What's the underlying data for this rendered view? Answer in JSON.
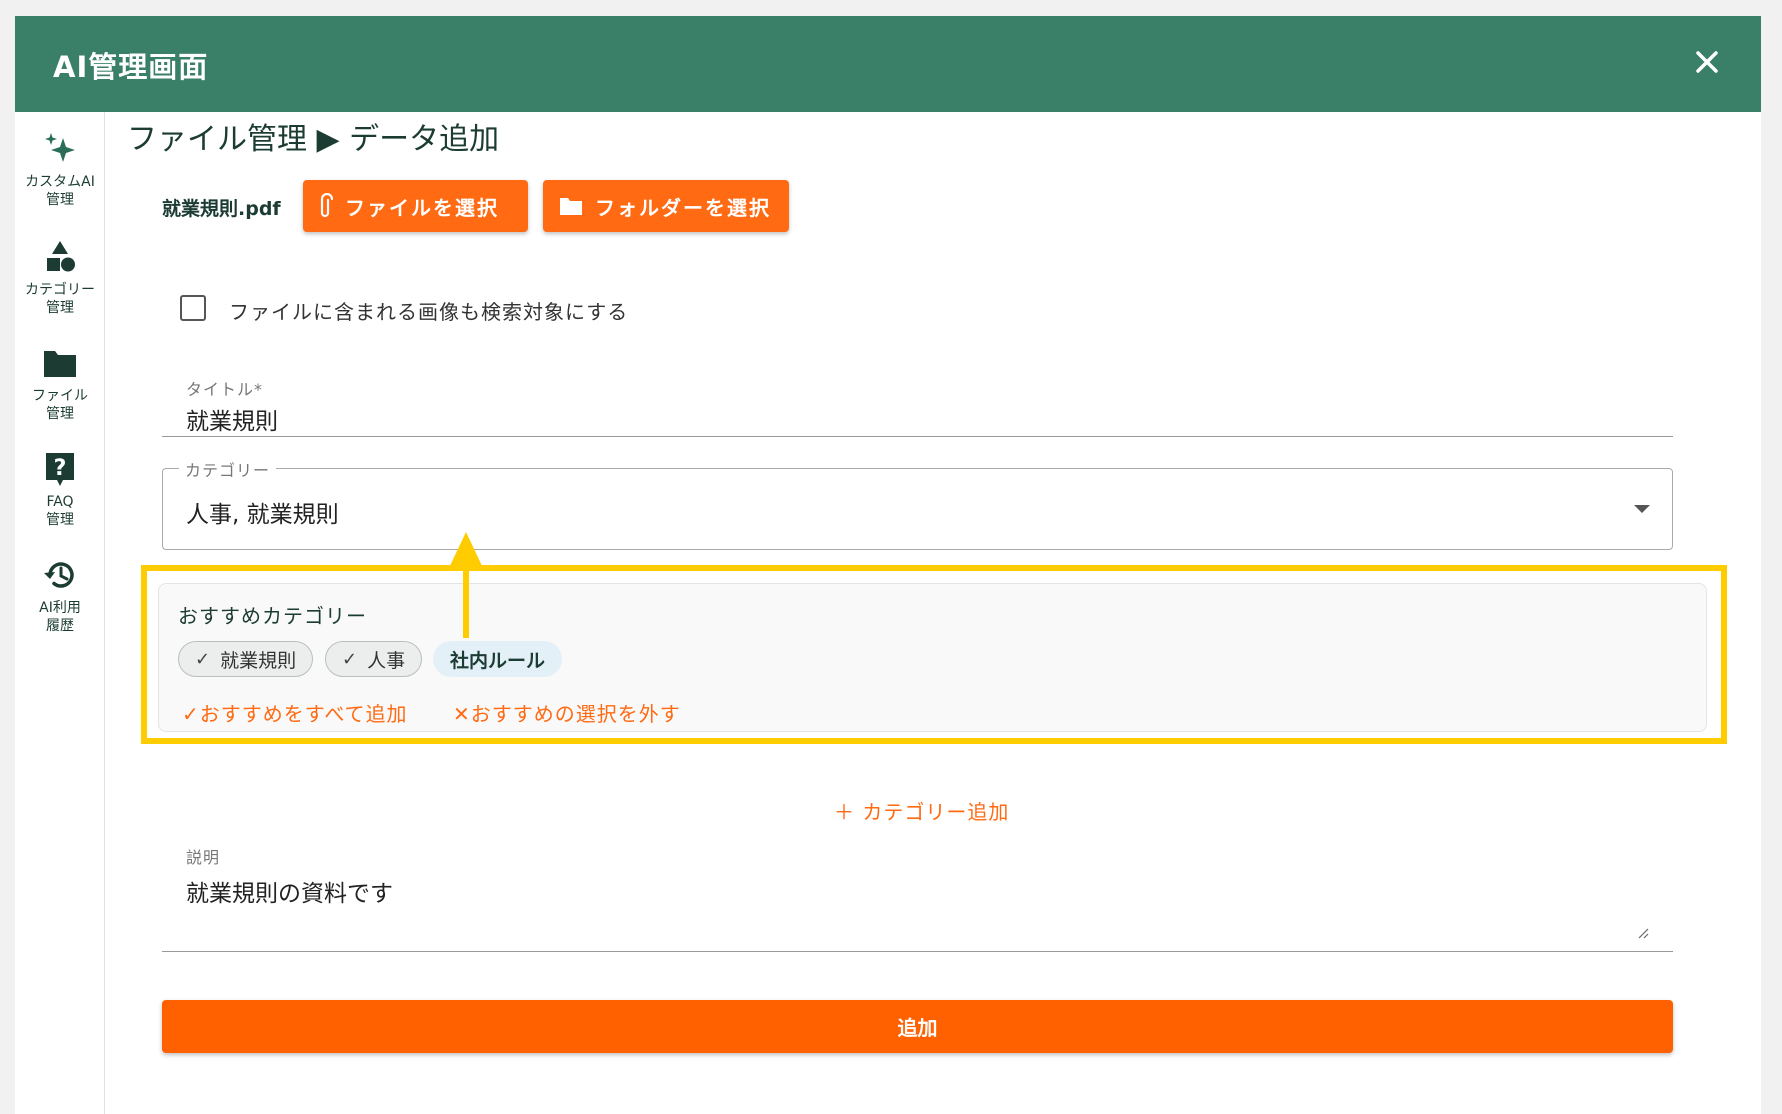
{
  "app": {
    "title": "AI管理画面",
    "header_color": "#3a7f68",
    "accent_color": "#ff6a13"
  },
  "sidebar": {
    "items": [
      {
        "label": "カスタムAI\n管理",
        "icon": "sparkle-icon"
      },
      {
        "label": "カテゴリー\n管理",
        "icon": "shapes-icon"
      },
      {
        "label": "ファイル\n管理",
        "icon": "folder-icon"
      },
      {
        "label": "FAQ\n管理",
        "icon": "help-icon"
      },
      {
        "label": "AI利用\n履歴",
        "icon": "history-icon"
      }
    ]
  },
  "breadcrumb": "ファイル管理 ▶ データ追加",
  "upload": {
    "file_name": "就業規則.pdf",
    "select_file_label": "ファイルを選択",
    "select_folder_label": "フォルダーを選択"
  },
  "options": {
    "include_images_label": "ファイルに含まれる画像も検索対象にする",
    "include_images_checked": false
  },
  "form": {
    "title_label": "タイトル*",
    "title_value": "就業規則",
    "category_label": "カテゴリー",
    "category_value": "人事, 就業規則",
    "description_label": "説明",
    "description_value": "就業規則の資料です",
    "add_category_label": "＋ カテゴリー追加",
    "submit_label": "追加"
  },
  "suggestions": {
    "title": "おすすめカテゴリー",
    "chips": [
      {
        "label": "就業規則",
        "selected": true,
        "check": "✓"
      },
      {
        "label": "人事",
        "selected": true,
        "check": "✓"
      },
      {
        "label": "社内ルール",
        "selected": false
      }
    ],
    "add_all_label": "✓おすすめをすべて追加",
    "clear_label": "✕おすすめの選択を外す",
    "highlight_color": "#ffcc00"
  }
}
